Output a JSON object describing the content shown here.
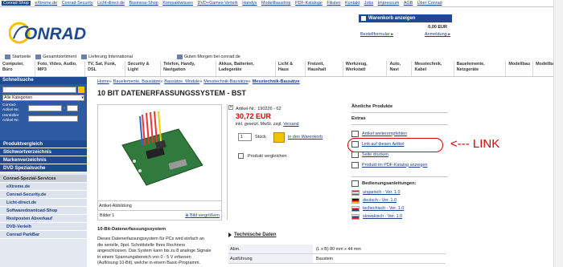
{
  "top_links": [
    {
      "label": "Conrad Shop",
      "current": true
    },
    {
      "label": "eXtreme.de"
    },
    {
      "label": "Conrad-Security"
    },
    {
      "label": "Licht-direct.de"
    },
    {
      "label": "Business-Shop"
    },
    {
      "label": "Kompaktwissen"
    },
    {
      "label": "DVD+Games-Verleih"
    },
    {
      "label": "Handys"
    },
    {
      "label": "Modellbaushop"
    },
    {
      "label": "PDF-Kataloge"
    },
    {
      "label": "Filialen"
    },
    {
      "label": "Kontakt"
    },
    {
      "label": "Jobs"
    },
    {
      "label": "Impressum"
    },
    {
      "label": "AGB"
    },
    {
      "label": "Über Conrad"
    }
  ],
  "logo": {
    "text": "CONRAD",
    "color": "#1e4a92",
    "accent": "#f2c200"
  },
  "cart": {
    "header": "Warenkorb anzeigen",
    "total": "0,00 EUR",
    "order_form": "Bestellformular",
    "login": "Anmeldung"
  },
  "nav_top": [
    {
      "label": "Startseite",
      "icon": "home-icon"
    },
    {
      "label": "Gesamtsortiment",
      "icon": "grid-icon"
    },
    {
      "label": "Lieferung International",
      "icon": "globe-icon"
    },
    {
      "label": "Guten Morgen bei conrad.de",
      "icon": "flag-icon"
    }
  ],
  "nav_categories": [
    "Computer, Büro",
    "Foto, Video, Audio, MP3",
    "TV, Sat, Funk, DSL",
    "Security & Light",
    "Telefon, Handy, Navigation",
    "Akkus, Batterien, Ladegeräte",
    "Licht & Haus",
    "Freizeit, Haushalt",
    "Werkzeug, Werkstatt",
    "Auto, Navi",
    "Messtechnik, Kabel",
    "Bauelemente, Netzgeräte",
    "Modellbau",
    "Modellbahn"
  ],
  "sidebar": {
    "search_header": "Schnellsuche",
    "category_select": "Alle Kategorien",
    "conrad_artnr_label": "Conrad-Artikel-Nr.",
    "hersteller_artnr_label": "Hersteller Artikel-Nr.",
    "items": [
      "Produktvergleich",
      "Stichwortverzeichnis",
      "Markenverzeichnis",
      "DVD Spezialsuche"
    ],
    "services_header": "Conrad-Spezial-Services",
    "services": [
      "eXtreme.de",
      "Conrad-Security.de",
      "Licht-direct.de",
      "Softwaredownload-Shop",
      "Restposten Abverkauf",
      "DVD-Verleih",
      "Conrad ParkBar"
    ]
  },
  "breadcrumb": [
    "Home",
    "»",
    "Bauelemente, Bausätze",
    "»",
    "Bausätze, Module",
    "»",
    "Messtechnik-Bausätze",
    "»",
    "Messtechnik-Bausätze"
  ],
  "product": {
    "title": "10 BIT DATENERFASSUNGSSYSTEM - BST",
    "artnr_label": "Artikel-Nr.: 190226 - 62",
    "price": "30,72 EUR",
    "vat_prefix": "inkl. gesetzl. MwSt. zzgl.",
    "vat_link": "Versand",
    "qty": "1",
    "qty_label": "Stück",
    "cart_link": "in den Warenkorb",
    "compare_label": "Produkt vergleichen",
    "image_caption": "Artikel-Abbildung",
    "images_label": "Bilder",
    "images_count": "1",
    "enlarge_label": "Bild vergrößern",
    "desc_title": "10-Bit-Datenerfassungssystem",
    "desc_lines": [
      "Dieses Datenerfassungssystem für PCs wird einfach an",
      "die serielle, 9pol. Schnittstelle Ihres Rechners",
      "angeschlossen. Das System kann bis zu 8 analoge Signale",
      "in einem Spannungsbereich von 0 - 5 V erfassen",
      "(Auflösung 10-Bit), welche in einem Basic-Programm."
    ]
  },
  "right_panel": {
    "similar_header": "Ähnliche Produkte",
    "extras_header": "Extras",
    "extras": [
      {
        "label": "Artikel weiterempfehlen",
        "icon": "mail-icon"
      },
      {
        "label": "Link auf diesen Artikel",
        "icon": "link-icon"
      },
      {
        "label": "Seite drucken",
        "icon": "print-icon"
      },
      {
        "label": "Produkt im PDF-Katalog anzeigen",
        "icon": "pdf-icon"
      }
    ],
    "manuals_header": "Bedienungsanleitungen:",
    "manuals": [
      {
        "label": "ungarisch - Ver. 1.0",
        "flag": [
          "#cd2a3e",
          "#ffffff",
          "#436f4d"
        ]
      },
      {
        "label": "deutsch - Ver. 1.0",
        "flag": [
          "#000000",
          "#dd0000",
          "#ffce00"
        ]
      },
      {
        "label": "tschechisch - Ver. 1.0",
        "flag": [
          "#ffffff",
          "#d7141a",
          "#11457e"
        ]
      },
      {
        "label": "slowakisch - Ver. 1.0",
        "flag": [
          "#ffffff",
          "#0b4ea2",
          "#ee1c25"
        ]
      }
    ]
  },
  "annotation": {
    "label": "<--- LINK",
    "color": "#dd0000"
  },
  "tech": {
    "title": "Technische Daten",
    "rows": [
      {
        "key": "Abm.",
        "value": "(L x B) 80 mm x 44 mm"
      },
      {
        "key": "Ausführung",
        "value": "Baustein"
      }
    ]
  }
}
